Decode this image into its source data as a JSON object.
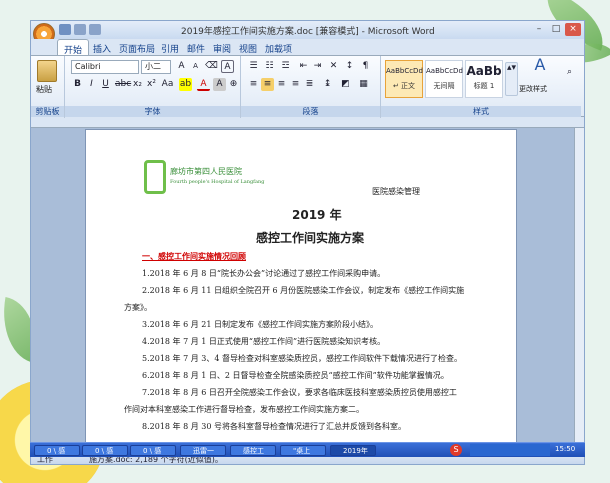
{
  "window": {
    "title": "2019年感控工作间实施方案.doc [兼容模式] - Microsoft Word"
  },
  "ribbon": {
    "tabs": [
      "开始",
      "插入",
      "页面布局",
      "引用",
      "邮件",
      "审阅",
      "视图",
      "加载项"
    ],
    "clipboard": {
      "paste_label": "粘贴",
      "group_label": "剪贴板"
    },
    "font": {
      "name": "Calibri",
      "size": "小二",
      "group_label": "字体"
    },
    "paragraph": {
      "group_label": "段落"
    },
    "styles": {
      "group_label": "样式",
      "items": [
        {
          "preview": "AaBbCcDd",
          "name": "↵ 正文"
        },
        {
          "preview": "AaBbCcDd",
          "name": "无间隔"
        },
        {
          "preview": "AaBb",
          "name": "标题 1"
        }
      ],
      "change_label": "更改样式"
    }
  },
  "document": {
    "logo_name": "廊坊市第四人民医院",
    "logo_sub": "Fourth people's Hospital of Langfang",
    "dept": "医院感染管理",
    "year_title": "2019 年",
    "main_title": "感控工作间实施方案",
    "section1": "一、感控工作间实施情况回顾",
    "lines": [
      "1.2018 年 6 月 8 日“院长办公会”讨论通过了感控工作间采购申请。",
      "2.2018 年 6 月 11 日组织全院召开 6 月份医院感染工作会议，制定发布《感控工作间实施",
      "方案》。",
      "3.2018 年 6 月 21 日制定发布《感控工作间实施方案阶段小结》。",
      "4.2018 年 7 月 1 日正式使用“感控工作间”进行医院感染知识考核。",
      "5.2018 年 7 月 3、4 督导检查对科室感染质控员，感控工作间软件下载情况进行了检查。",
      "6.2018 年 8 月 1 日、2 日督导检查全院感染质控员“感控工作间”软件功能掌握情况。",
      "7.2018 年 8 月 6 日召开全院感染工作会议，要求各临床医技科室感染质控员使用感控工",
      "作间对本科室感染工作进行督导检查，发布感控工作间实施方案二。",
      "8.2018 年 8 月 30 号将各科室督导检查情况进行了汇总并反馈到各科室。"
    ]
  },
  "status": {
    "left": "工作",
    "doc_info": "施方案.doc: 2,189 个字符(近似值)。"
  },
  "taskbar": {
    "items": [
      "0 \\ 感",
      "0 \\ 感",
      "0 \\ 感",
      "迅雷一",
      "感控工",
      "\"桌上",
      "2019年"
    ],
    "clock": "15:50"
  }
}
